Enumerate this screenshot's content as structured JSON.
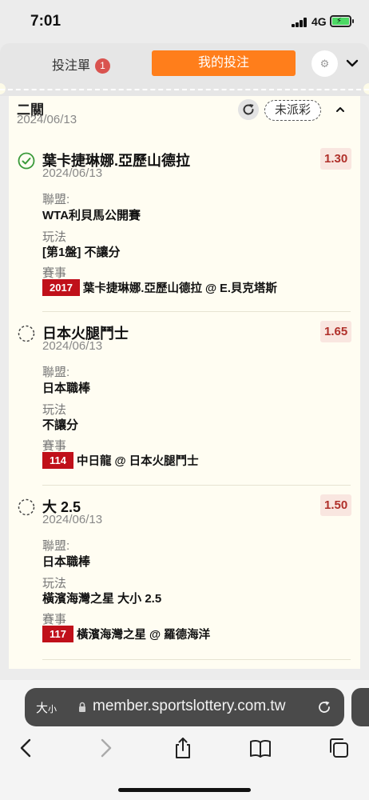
{
  "status_bar": {
    "time": "7:01",
    "network": "4G"
  },
  "header": {
    "slip_tab_label": "投注單",
    "slip_count": "1",
    "my_bets_tab_label": "我的投注"
  },
  "parlay": {
    "title": "二關",
    "date": "2024/06/13",
    "result_status": "未派彩"
  },
  "labels": {
    "league": "聯盟:",
    "play_type": "玩法",
    "event": "賽事"
  },
  "bets": [
    {
      "selection": "葉卡捷琳娜.亞歷山德拉",
      "date": "2024/06/13",
      "odds": "1.30",
      "league": "WTA利貝馬公開賽",
      "play_type": "[第1盤] 不讓分",
      "event_code": "2017",
      "event_name": "葉卡捷琳娜.亞歷山德拉 @ E.貝克塔斯",
      "status": "won"
    },
    {
      "selection": "日本火腿鬥士",
      "date": "2024/06/13",
      "odds": "1.65",
      "league": "日本職棒",
      "play_type": "不讓分",
      "event_code": "114",
      "event_name": "中日龍 @ 日本火腿鬥士",
      "status": "pending"
    },
    {
      "selection": "大 2.5",
      "date": "2024/06/13",
      "odds": "1.50",
      "league": "日本職棒",
      "play_type": "橫濱海灣之星 大小 2.5",
      "event_code": "117",
      "event_name": "橫濱海灣之星 @ 羅德海洋",
      "status": "pending"
    }
  ],
  "browser": {
    "text_size_label": "大",
    "text_size_small": "小",
    "url": "member.sportslottery.com.tw"
  },
  "colors": {
    "accent": "#ff7e1b",
    "odds_text": "#b0302a",
    "event_code_bg": "#c0101a",
    "win_green": "#3a9a3a"
  }
}
